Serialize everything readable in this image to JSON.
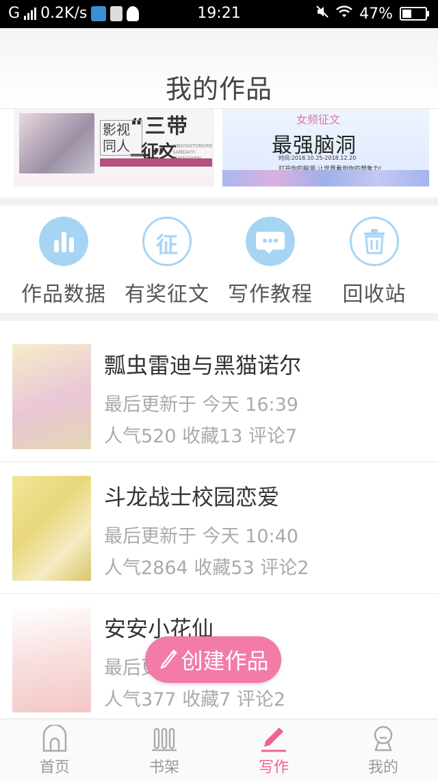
{
  "status_bar": {
    "network": "G",
    "speed": "0.2K/s",
    "time": "19:21",
    "battery": "47%",
    "battery_level": 0.47
  },
  "header": {
    "title": "我的作品"
  },
  "banners": [
    {
      "quote": "“三带一”",
      "label_a": "影视同人",
      "label_b": "征文",
      "en_text": "YINGSHITONGREN SANDAIYI ZHENGWEN"
    },
    {
      "tag": "女频征文",
      "title": "最强脑洞",
      "date": "时间:2018.10.25-2018.12.20",
      "note": "打开你的脑洞,让世界看到你的想象力!"
    }
  ],
  "actions": [
    {
      "label": "作品数据",
      "icon": "bar-chart-icon"
    },
    {
      "label": "有奖征文",
      "icon": "contest-icon",
      "glyph": "征"
    },
    {
      "label": "写作教程",
      "icon": "chat-bubble-icon"
    },
    {
      "label": "回收站",
      "icon": "trash-icon"
    }
  ],
  "works": [
    {
      "title": "瓢虫雷迪与黑猫诺尔",
      "updated": "最后更新于 今天 16:39",
      "stats": "人气520 收藏13 评论7"
    },
    {
      "title": "斗龙战士校园恋爱",
      "updated": "最后更新于 今天 10:40",
      "stats": "人气2864 收藏53 评论2"
    },
    {
      "title": "安安小花仙",
      "updated": "最后更新于",
      "stats": "人气377 收藏7 评论2"
    }
  ],
  "fab": {
    "label": "创建作品",
    "icon": "pencil-icon"
  },
  "tabs": [
    {
      "label": "首页",
      "icon": "home-icon"
    },
    {
      "label": "书架",
      "icon": "bookshelf-icon"
    },
    {
      "label": "写作",
      "icon": "pencil-icon",
      "active": true
    },
    {
      "label": "我的",
      "icon": "profile-icon"
    }
  ],
  "colors": {
    "accent_pink": "#f06195",
    "fab_pink": "#f37ba8",
    "icon_blue": "#a6d5f3"
  }
}
